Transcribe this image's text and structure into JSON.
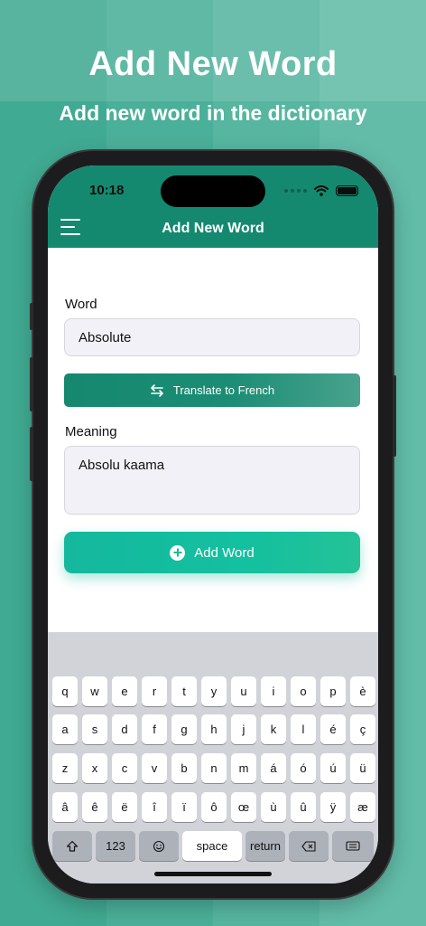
{
  "promo": {
    "title": "Add New Word",
    "subtitle": "Add new word in the dictionary"
  },
  "status_bar": {
    "time": "10:18"
  },
  "nav": {
    "title": "Add New Word",
    "menu_icon": "hamburger-menu-icon"
  },
  "form": {
    "word_label": "Word",
    "word_value": "Absolute",
    "translate_button": "Translate to French",
    "translate_icon": "swap-arrows-icon",
    "meaning_label": "Meaning",
    "meaning_value": "Absolu kaama",
    "add_button": "Add Word",
    "add_icon": "plus-circle-icon"
  },
  "keyboard": {
    "rows": [
      [
        "q",
        "w",
        "e",
        "r",
        "t",
        "y",
        "u",
        "i",
        "o",
        "p",
        "è"
      ],
      [
        "a",
        "s",
        "d",
        "f",
        "g",
        "h",
        "j",
        "k",
        "l",
        "é",
        "ç"
      ],
      [
        "z",
        "x",
        "c",
        "v",
        "b",
        "n",
        "m",
        "á",
        "ó",
        "ú",
        "ü"
      ],
      [
        "â",
        "ê",
        "ë",
        "î",
        "ï",
        "ô",
        "œ",
        "ù",
        "û",
        "ÿ",
        "æ"
      ]
    ],
    "shift_icon": "shift-icon",
    "numbers_label": "123",
    "emoji_icon": "emoji-icon",
    "space_label": "space",
    "return_label": "return",
    "delete_icon": "backspace-icon",
    "hide_icon": "keyboard-hide-icon"
  },
  "colors": {
    "accent": "#15896f",
    "button": "#15b89d",
    "background": "#41ab93"
  }
}
